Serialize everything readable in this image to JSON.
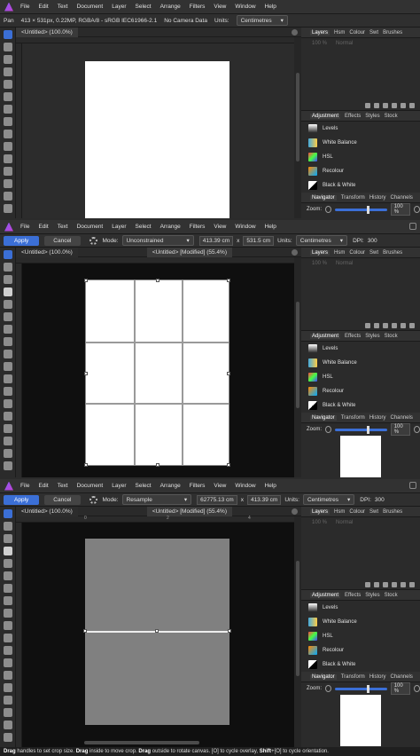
{
  "menu": [
    "File",
    "Edit",
    "Text",
    "Document",
    "Layer",
    "Select",
    "Arrange",
    "Filters",
    "View",
    "Window",
    "Help"
  ],
  "studio_tabs_top": [
    "Layers",
    "Hsm",
    "Colour",
    "Swt",
    "Brushes"
  ],
  "studio_tabs_mid": [
    "Adjustment",
    "Effects",
    "Styles",
    "Stock"
  ],
  "studio_tabs_bot": [
    "Navigator",
    "Transform",
    "History",
    "Channels"
  ],
  "layers_opacity": "100 %",
  "layers_blend": "Normal",
  "adjustments": [
    "Levels",
    "White Balance",
    "HSL",
    "Recolour",
    "Black & White"
  ],
  "zoom_label": "Zoom:",
  "zoom_value": "100 %",
  "panel1": {
    "tool_name": "Pan",
    "info": "413 × 531px, 0.22MP, RGBA/8 - sRGB IEC61966-2.1",
    "camera": "No Camera Data",
    "units_label": "Units:",
    "units_value": "Centimetres",
    "tab": "<Untitled> (100.0%)"
  },
  "panel2": {
    "apply": "Apply",
    "cancel": "Cancel",
    "mode_label": "Mode:",
    "mode_value": "Unconstrained",
    "width": "413.39 cm",
    "x": "x",
    "height": "531.5 cm",
    "units_label": "Units:",
    "units_value": "Centimetres",
    "dpi_label": "DPI:",
    "dpi_value": "300",
    "tab1": "<Untitled> (100.0%)",
    "tab2": "<Untitled> [Modified] (55.4%)"
  },
  "panel3": {
    "apply": "Apply",
    "cancel": "Cancel",
    "mode_label": "Mode:",
    "mode_value": "Resample",
    "width": "62775.13 cm",
    "x": "x",
    "height": "413.39 cm",
    "units_label": "Units:",
    "units_value": "Centimetres",
    "dpi_label": "DPI:",
    "dpi_value": "300",
    "tab1": "<Untitled> (100.0%)",
    "tab2": "<Untitled> [Modified] (55.4%)"
  },
  "ruler_ticks_top": [
    "0",
    "2",
    "4"
  ],
  "status": {
    "drag1": "Drag",
    "t1": " handles to set crop size. ",
    "drag2": "Drag",
    "t2": " inside to move crop. ",
    "drag3": "Drag",
    "t3": " outside to rotate canvas. [O] to cycle overlay, ",
    "shift": "Shift",
    "t4": "+[O] to cycle orientation."
  },
  "colors": {
    "accent": "#3b6fd6",
    "canvas_dark": "#0f0f0f",
    "page_gray": "#808080"
  }
}
